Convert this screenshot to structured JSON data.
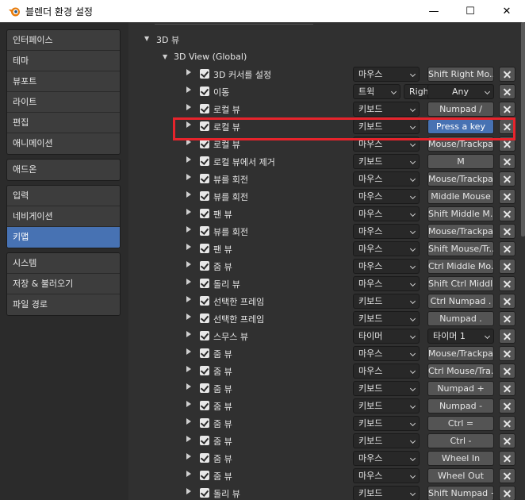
{
  "window": {
    "title": "블렌더 환경 설정",
    "minimize_glyph": "—",
    "maximize_glyph": "☐",
    "close_glyph": "✕"
  },
  "sidebar": {
    "groups": [
      [
        "인터페이스",
        "테마",
        "뷰포트",
        "라이트",
        "편집",
        "애니메이션"
      ],
      [
        "애드온"
      ],
      [
        "입력",
        "네비게이션",
        "키맵"
      ],
      [
        "시스템",
        "저장 & 불러오기",
        "파일 경로"
      ]
    ],
    "active": "키맵"
  },
  "tree": {
    "section": "3D 뷰",
    "subsection": "3D View (Global)"
  },
  "rows": [
    {
      "label": "3D 커서를 설정",
      "type": "마우스",
      "key": "Shift Right Mo..."
    },
    {
      "label": "이동",
      "type": "트윅",
      "direction": "Right",
      "modifier": "Any"
    },
    {
      "label": "로컬 뷰",
      "type": "키보드",
      "key": "Numpad /"
    },
    {
      "label": "로컬 뷰",
      "type": "키보드",
      "key": "Press a key",
      "pressed": true
    },
    {
      "label": "로컬 뷰",
      "type": "마우스",
      "key": "Mouse/Trackpa..."
    },
    {
      "label": "로컬 뷰에서 제거",
      "type": "키보드",
      "key": "M"
    },
    {
      "label": "뷰를 회전",
      "type": "마우스",
      "key": "Mouse/Trackpa..."
    },
    {
      "label": "뷰를 회전",
      "type": "마우스",
      "key": "Middle Mouse"
    },
    {
      "label": "팬 뷰",
      "type": "마우스",
      "key": "Shift Middle M..."
    },
    {
      "label": "뷰를 회전",
      "type": "마우스",
      "key": "Mouse/Trackpa..."
    },
    {
      "label": "팬 뷰",
      "type": "마우스",
      "key": "Shift Mouse/Tr..."
    },
    {
      "label": "줌 뷰",
      "type": "마우스",
      "key": "Ctrl Middle Mo..."
    },
    {
      "label": "돌리 뷰",
      "type": "마우스",
      "key": "Shift Ctrl Middl..."
    },
    {
      "label": "선택한 프레임",
      "type": "키보드",
      "key": "Ctrl Numpad ."
    },
    {
      "label": "선택한 프레임",
      "type": "키보드",
      "key": "Numpad ."
    },
    {
      "label": "스무스 뷰",
      "type": "타이머",
      "key": "타이머 1",
      "key_is_dropdown": true
    },
    {
      "label": "줌 뷰",
      "type": "마우스",
      "key": "Mouse/Trackpa..."
    },
    {
      "label": "줌 뷰",
      "type": "마우스",
      "key": "Ctrl Mouse/Tra..."
    },
    {
      "label": "줌 뷰",
      "type": "키보드",
      "key": "Numpad +"
    },
    {
      "label": "줌 뷰",
      "type": "키보드",
      "key": "Numpad -"
    },
    {
      "label": "줌 뷰",
      "type": "키보드",
      "key": "Ctrl ="
    },
    {
      "label": "줌 뷰",
      "type": "키보드",
      "key": "Ctrl -"
    },
    {
      "label": "줌 뷰",
      "type": "마우스",
      "key": "Wheel In"
    },
    {
      "label": "줌 뷰",
      "type": "마우스",
      "key": "Wheel Out"
    },
    {
      "label": "돌리 뷰",
      "type": "키보드",
      "key": "Shift Numpad +"
    }
  ],
  "colors": {
    "accent": "#4772b3",
    "highlight_box": "#e6242c"
  }
}
